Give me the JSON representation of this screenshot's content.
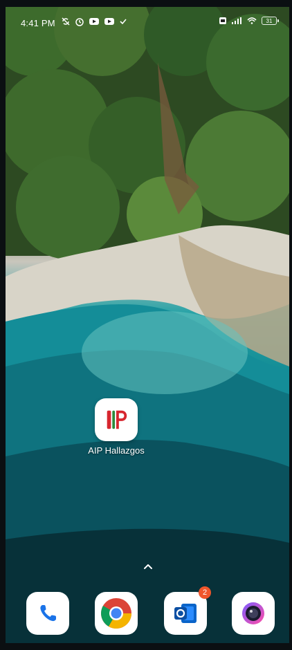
{
  "status_bar": {
    "time": "4:41 PM",
    "battery_level": "31",
    "icons_left": [
      "sync-off-icon",
      "alarm-icon",
      "youtube-icon",
      "youtube-icon",
      "check-icon"
    ],
    "icons_right": [
      "sim-icon",
      "signal-icon",
      "wifi-icon",
      "battery-icon"
    ]
  },
  "home_apps": [
    {
      "label": "AIP Hallazgos",
      "icon": "aip-logo-icon"
    }
  ],
  "dock": {
    "apps": [
      {
        "name": "phone",
        "icon": "phone-icon",
        "badge": ""
      },
      {
        "name": "chrome",
        "icon": "chrome-icon",
        "badge": ""
      },
      {
        "name": "outlook",
        "icon": "outlook-icon",
        "badge": "2"
      },
      {
        "name": "camera",
        "icon": "camera-icon",
        "badge": ""
      }
    ]
  },
  "colors": {
    "badge": "#f0562b",
    "aip_red": "#d7262f",
    "aip_green": "#2d8a3b",
    "phone_blue": "#1a73e8",
    "outlook_blue": "#0a64c9"
  }
}
